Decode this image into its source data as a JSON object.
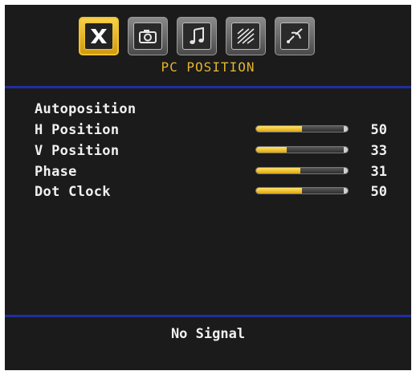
{
  "header": {
    "title": "PC POSITION",
    "tabs": [
      {
        "icon": "settings-icon",
        "active": true
      },
      {
        "icon": "camera-icon",
        "active": false
      },
      {
        "icon": "music-note-icon",
        "active": false
      },
      {
        "icon": "picture-lines-icon",
        "active": false
      },
      {
        "icon": "satellite-dish-icon",
        "active": false
      }
    ]
  },
  "menu": {
    "autoposition_label": "Autoposition",
    "items": [
      {
        "label": "H Position",
        "value": "50",
        "level": 0.5
      },
      {
        "label": "V Position",
        "value": "33",
        "level": 0.33
      },
      {
        "label": "Phase",
        "value": "31",
        "level": 0.48
      },
      {
        "label": "Dot Clock",
        "value": "50",
        "level": 0.5
      }
    ]
  },
  "footer": {
    "status": "No Signal"
  },
  "colors": {
    "background": "#1b1b1b",
    "divider": "#1f2ea0",
    "accent": "#e3b430",
    "text": "#f0f0f0"
  }
}
